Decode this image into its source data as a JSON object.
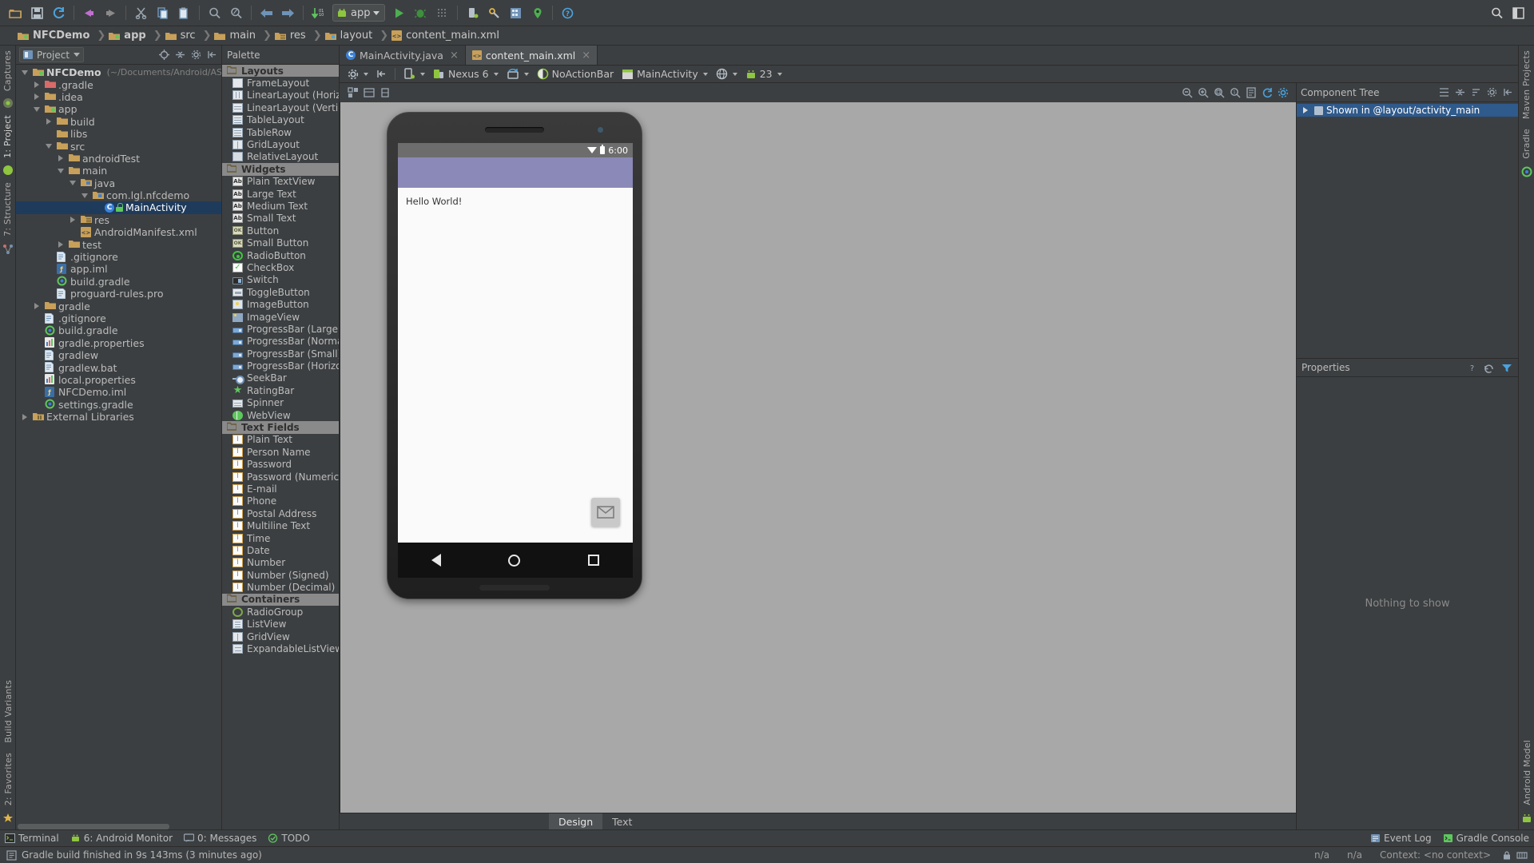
{
  "toolbar": {
    "icons": [
      {
        "name": "open-folder-icon",
        "glyph": "folder"
      },
      {
        "name": "save-all-icon",
        "glyph": "save"
      },
      {
        "name": "sync-icon",
        "glyph": "sync"
      },
      {
        "name": "undo-icon",
        "glyph": "undo"
      },
      {
        "name": "redo-icon",
        "glyph": "redo"
      },
      {
        "name": "cut-icon",
        "glyph": "cut"
      },
      {
        "name": "copy-icon",
        "glyph": "copy"
      },
      {
        "name": "paste-icon",
        "glyph": "paste"
      },
      {
        "name": "find-icon",
        "glyph": "search"
      },
      {
        "name": "replace-icon",
        "glyph": "replace"
      },
      {
        "name": "back-icon",
        "glyph": "arrow-left"
      },
      {
        "name": "forward-icon",
        "glyph": "arrow-right"
      },
      {
        "name": "compile-icon",
        "glyph": "compile"
      }
    ],
    "run_config_label": "app",
    "right_icons": [
      {
        "name": "run-icon",
        "glyph": "play"
      },
      {
        "name": "debug-icon",
        "glyph": "bug"
      },
      {
        "name": "coverage-icon",
        "glyph": "coverage"
      },
      {
        "name": "avd-manager-icon",
        "glyph": "device"
      },
      {
        "name": "sdk-manager-icon",
        "glyph": "sdk"
      },
      {
        "name": "project-structure-icon",
        "glyph": "structure"
      },
      {
        "name": "settings-icon",
        "glyph": "gear"
      },
      {
        "name": "help-icon",
        "glyph": "question"
      }
    ],
    "far_right_icons": [
      {
        "name": "search-everywhere-icon",
        "glyph": "search"
      },
      {
        "name": "layout-icon",
        "glyph": "layout"
      }
    ]
  },
  "breadcrumb": [
    {
      "label": "NFCDemo",
      "icon": "module-icon",
      "bold": true
    },
    {
      "label": "app",
      "icon": "module-icon",
      "bold": true
    },
    {
      "label": "src",
      "icon": "folder-icon",
      "bold": false
    },
    {
      "label": "main",
      "icon": "folder-icon",
      "bold": false
    },
    {
      "label": "res",
      "icon": "res-folder-icon",
      "bold": false
    },
    {
      "label": "layout",
      "icon": "layout-folder-icon",
      "bold": false
    },
    {
      "label": "content_main.xml",
      "icon": "xml-file-icon",
      "bold": false
    }
  ],
  "left_strip": {
    "top_labels": [
      "Captures"
    ],
    "labels": [
      "1: Project",
      "7: Structure"
    ],
    "bottom_labels": [
      "2: Favorites",
      "Build Variants"
    ]
  },
  "right_strip": {
    "labels": [
      "Maven Projects",
      "Gradle"
    ],
    "bottom_labels": [
      "Android Model"
    ]
  },
  "project_panel": {
    "selector_label": "Project",
    "header_icons": [
      "collapse-all-icon",
      "split-icon",
      "settings-icon",
      "hide-icon"
    ],
    "tree": [
      {
        "depth": 0,
        "label": "NFCDemo",
        "suffix": "(~/Documents/Android/ASCode/",
        "icon": "module-icon",
        "arrow": "down",
        "bold": true,
        "selected": false
      },
      {
        "depth": 1,
        "label": ".gradle",
        "icon": "folder-red-icon",
        "arrow": "right",
        "bold": false,
        "selected": false
      },
      {
        "depth": 1,
        "label": ".idea",
        "icon": "folder-icon",
        "arrow": "right",
        "bold": false,
        "selected": false
      },
      {
        "depth": 1,
        "label": "app",
        "icon": "module-icon",
        "arrow": "down",
        "bold": false,
        "selected": false
      },
      {
        "depth": 2,
        "label": "build",
        "icon": "folder-icon",
        "arrow": "right",
        "bold": false,
        "selected": false
      },
      {
        "depth": 2,
        "label": "libs",
        "icon": "folder-icon",
        "arrow": "none",
        "bold": false,
        "selected": false
      },
      {
        "depth": 2,
        "label": "src",
        "icon": "folder-icon",
        "arrow": "down",
        "bold": false,
        "selected": false
      },
      {
        "depth": 3,
        "label": "androidTest",
        "icon": "folder-icon",
        "arrow": "right",
        "bold": false,
        "selected": false
      },
      {
        "depth": 3,
        "label": "main",
        "icon": "folder-icon",
        "arrow": "down",
        "bold": false,
        "selected": false
      },
      {
        "depth": 4,
        "label": "java",
        "icon": "folder-blue-icon",
        "arrow": "down",
        "bold": false,
        "selected": false
      },
      {
        "depth": 5,
        "label": "com.lgl.nfcdemo",
        "icon": "package-icon",
        "arrow": "down",
        "bold": false,
        "selected": false
      },
      {
        "depth": 6,
        "label": "MainActivity",
        "icon": "java-class-icon",
        "arrow": "none",
        "bold": false,
        "selected": true
      },
      {
        "depth": 4,
        "label": "res",
        "icon": "res-folder-icon",
        "arrow": "right",
        "bold": false,
        "selected": false
      },
      {
        "depth": 4,
        "label": "AndroidManifest.xml",
        "icon": "xml-file-icon",
        "arrow": "none",
        "bold": false,
        "selected": false
      },
      {
        "depth": 3,
        "label": "test",
        "icon": "folder-icon",
        "arrow": "right",
        "bold": false,
        "selected": false
      },
      {
        "depth": 2,
        "label": ".gitignore",
        "icon": "file-icon",
        "arrow": "none",
        "bold": false,
        "selected": false
      },
      {
        "depth": 2,
        "label": "app.iml",
        "icon": "iml-file-icon",
        "arrow": "none",
        "bold": false,
        "selected": false
      },
      {
        "depth": 2,
        "label": "build.gradle",
        "icon": "gradle-file-icon",
        "arrow": "none",
        "bold": false,
        "selected": false
      },
      {
        "depth": 2,
        "label": "proguard-rules.pro",
        "icon": "file-icon",
        "arrow": "none",
        "bold": false,
        "selected": false
      },
      {
        "depth": 1,
        "label": "gradle",
        "icon": "folder-icon",
        "arrow": "right",
        "bold": false,
        "selected": false
      },
      {
        "depth": 1,
        "label": ".gitignore",
        "icon": "file-icon",
        "arrow": "none",
        "bold": false,
        "selected": false
      },
      {
        "depth": 1,
        "label": "build.gradle",
        "icon": "gradle-file-icon",
        "arrow": "none",
        "bold": false,
        "selected": false
      },
      {
        "depth": 1,
        "label": "gradle.properties",
        "icon": "properties-file-icon",
        "arrow": "none",
        "bold": false,
        "selected": false
      },
      {
        "depth": 1,
        "label": "gradlew",
        "icon": "file-icon",
        "arrow": "none",
        "bold": false,
        "selected": false
      },
      {
        "depth": 1,
        "label": "gradlew.bat",
        "icon": "file-icon",
        "arrow": "none",
        "bold": false,
        "selected": false
      },
      {
        "depth": 1,
        "label": "local.properties",
        "icon": "properties-file-icon",
        "arrow": "none",
        "bold": false,
        "selected": false
      },
      {
        "depth": 1,
        "label": "NFCDemo.iml",
        "icon": "iml-file-icon",
        "arrow": "none",
        "bold": false,
        "selected": false
      },
      {
        "depth": 1,
        "label": "settings.gradle",
        "icon": "gradle-file-icon",
        "arrow": "none",
        "bold": false,
        "selected": false
      },
      {
        "depth": 0,
        "label": "External Libraries",
        "icon": "library-icon",
        "arrow": "right",
        "bold": false,
        "selected": false
      }
    ]
  },
  "palette": {
    "title": "Palette",
    "header_icons": [
      "filter-icon",
      "gear-icon",
      "hide-icon"
    ],
    "groups": [
      {
        "label": "Layouts",
        "items": [
          {
            "label": "FrameLayout",
            "icon": "frame-layout-icon"
          },
          {
            "label": "LinearLayout (Horizontal)",
            "icon": "linear-horizontal-icon"
          },
          {
            "label": "LinearLayout (Vertical)",
            "icon": "linear-vertical-icon"
          },
          {
            "label": "TableLayout",
            "icon": "table-layout-icon"
          },
          {
            "label": "TableRow",
            "icon": "table-row-icon"
          },
          {
            "label": "GridLayout",
            "icon": "grid-layout-icon"
          },
          {
            "label": "RelativeLayout",
            "icon": "relative-layout-icon"
          }
        ]
      },
      {
        "label": "Widgets",
        "items": [
          {
            "label": "Plain TextView",
            "icon": "text-ab-icon"
          },
          {
            "label": "Large Text",
            "icon": "text-ab-icon"
          },
          {
            "label": "Medium Text",
            "icon": "text-ab-icon"
          },
          {
            "label": "Small Text",
            "icon": "text-ab-icon"
          },
          {
            "label": "Button",
            "icon": "button-ok-icon"
          },
          {
            "label": "Small Button",
            "icon": "button-ok-icon"
          },
          {
            "label": "RadioButton",
            "icon": "radio-button-icon"
          },
          {
            "label": "CheckBox",
            "icon": "checkbox-icon"
          },
          {
            "label": "Switch",
            "icon": "switch-icon"
          },
          {
            "label": "ToggleButton",
            "icon": "toggle-button-icon"
          },
          {
            "label": "ImageButton",
            "icon": "image-button-icon"
          },
          {
            "label": "ImageView",
            "icon": "image-view-icon"
          },
          {
            "label": "ProgressBar (Large)",
            "icon": "progress-bar-icon"
          },
          {
            "label": "ProgressBar (Normal)",
            "icon": "progress-bar-icon"
          },
          {
            "label": "ProgressBar (Small)",
            "icon": "progress-bar-icon"
          },
          {
            "label": "ProgressBar (Horizontal)",
            "icon": "progress-bar-icon"
          },
          {
            "label": "SeekBar",
            "icon": "seek-bar-icon"
          },
          {
            "label": "RatingBar",
            "icon": "rating-star-icon"
          },
          {
            "label": "Spinner",
            "icon": "spinner-icon"
          },
          {
            "label": "WebView",
            "icon": "web-view-icon"
          }
        ]
      },
      {
        "label": "Text Fields",
        "items": [
          {
            "label": "Plain Text",
            "icon": "text-field-icon"
          },
          {
            "label": "Person Name",
            "icon": "text-field-icon"
          },
          {
            "label": "Password",
            "icon": "text-field-icon"
          },
          {
            "label": "Password (Numeric)",
            "icon": "text-field-icon"
          },
          {
            "label": "E-mail",
            "icon": "text-field-icon"
          },
          {
            "label": "Phone",
            "icon": "text-field-icon"
          },
          {
            "label": "Postal Address",
            "icon": "text-field-icon"
          },
          {
            "label": "Multiline Text",
            "icon": "text-field-icon"
          },
          {
            "label": "Time",
            "icon": "text-field-icon"
          },
          {
            "label": "Date",
            "icon": "text-field-icon"
          },
          {
            "label": "Number",
            "icon": "text-field-icon"
          },
          {
            "label": "Number (Signed)",
            "icon": "text-field-icon"
          },
          {
            "label": "Number (Decimal)",
            "icon": "text-field-icon"
          }
        ]
      },
      {
        "label": "Containers",
        "items": [
          {
            "label": "RadioGroup",
            "icon": "radio-group-icon"
          },
          {
            "label": "ListView",
            "icon": "list-view-icon"
          },
          {
            "label": "GridView",
            "icon": "grid-view-icon"
          },
          {
            "label": "ExpandableListView",
            "icon": "expandable-list-icon"
          }
        ]
      }
    ]
  },
  "editor_tabs": [
    {
      "label": "MainActivity.java",
      "icon": "java-class-icon",
      "active": false,
      "close": "×"
    },
    {
      "label": "content_main.xml",
      "icon": "xml-file-icon",
      "active": true,
      "close": "×"
    }
  ],
  "designer_toolbar": {
    "items": [
      {
        "name": "designer-settings",
        "label": "",
        "icon": "gear-icon",
        "caret": true
      },
      {
        "name": "designer-hide",
        "label": "",
        "icon": "hide-icon",
        "caret": false
      },
      {
        "name": "device-type",
        "label": "",
        "icon": "phone-icon",
        "caret": true
      },
      {
        "name": "device-select",
        "label": "Nexus 6",
        "icon": "device-icon",
        "caret": true
      },
      {
        "name": "orientation-select",
        "label": "",
        "icon": "rotate-icon",
        "caret": true
      },
      {
        "name": "theme-select",
        "label": "NoActionBar",
        "icon": "theme-icon",
        "caret": false
      },
      {
        "name": "activity-select",
        "label": "MainActivity",
        "icon": "activity-icon",
        "caret": true
      },
      {
        "name": "locale-select",
        "label": "",
        "icon": "globe-icon",
        "caret": true
      },
      {
        "name": "api-select",
        "label": "23",
        "icon": "android-icon",
        "caret": true
      }
    ]
  },
  "canvas_toolbar": {
    "left_icons": [
      "palette-toggle-icon",
      "blueprint-icon",
      "constraints-icon"
    ],
    "right_icons": [
      "zoom-out-icon",
      "zoom-in-icon",
      "zoom-fit-icon",
      "zoom-actual-icon",
      "zoom-reset-icon",
      "screenshot-icon",
      "refresh-icon",
      "settings-icon"
    ]
  },
  "device_preview": {
    "status_time": "6:00",
    "hello_text": "Hello World!",
    "fab_icon": "envelope-icon",
    "nav_icons": [
      "back-triangle-icon",
      "home-circle-icon",
      "recents-square-icon"
    ],
    "appbar_color": "#8b89b8",
    "content_color": "#fafafa"
  },
  "component_tree": {
    "title": "Component Tree",
    "header_icons": [
      "expand-all-icon",
      "collapse-all-icon",
      "sort-icon",
      "gear-icon",
      "hide-icon"
    ],
    "root_label": "Shown in @layout/activity_main",
    "root_icon": "layout-icon"
  },
  "properties": {
    "title": "Properties",
    "help_icon": "question-icon",
    "reset_icon": "revert-icon",
    "filter_icon": "filter-icon",
    "empty_text": "Nothing to show"
  },
  "designer_tabs": [
    {
      "label": "Design",
      "active": true
    },
    {
      "label": "Text",
      "active": false
    }
  ],
  "tool_window_bar": [
    {
      "label": "Terminal",
      "icon": "terminal-icon"
    },
    {
      "label": "6: Android Monitor",
      "icon": "android-monitor-icon"
    },
    {
      "label": "0: Messages",
      "icon": "messages-icon"
    },
    {
      "label": "TODO",
      "icon": "todo-icon"
    }
  ],
  "tool_window_bar_right": [
    {
      "label": "Event Log",
      "icon": "event-log-icon"
    },
    {
      "label": "Gradle Console",
      "icon": "gradle-console-icon"
    }
  ],
  "status_bar": {
    "message": "Gradle build finished in 9s 143ms (3 minutes ago)",
    "icon": "info-icon",
    "cells": [
      "n/a",
      "n/a",
      "Context: <no context>"
    ],
    "right_icons": [
      "lock-icon",
      "memory-icon"
    ]
  }
}
